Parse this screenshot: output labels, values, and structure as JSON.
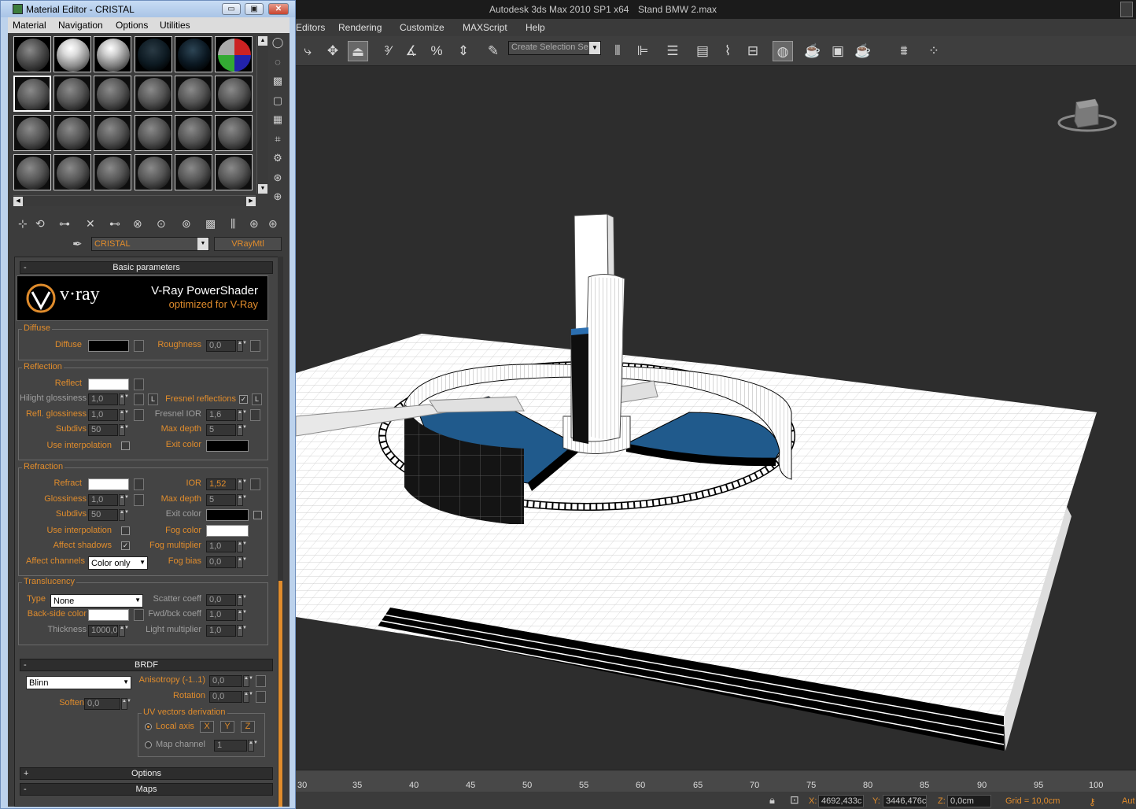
{
  "app": {
    "title_app": "Autodesk 3ds Max  2010 SP1 x64",
    "title_file": "Stand BMW 2.max",
    "menu": [
      "Editors",
      "Rendering",
      "Customize",
      "MAXScript",
      "Help"
    ],
    "selection_set_placeholder": "Create Selection Se",
    "timeline_ticks": [
      "30",
      "35",
      "40",
      "45",
      "50",
      "55",
      "60",
      "65",
      "70",
      "75",
      "80",
      "85",
      "90",
      "95",
      "100"
    ],
    "status": {
      "x_label": "X:",
      "x_value": "4692,433c",
      "y_label": "Y:",
      "y_value": "3446,476c",
      "z_label": "Z:",
      "z_value": "0,0cm",
      "grid": "Grid = 10,0cm",
      "auto": "Aut"
    }
  },
  "material_editor": {
    "title": "Material Editor - CRISTAL",
    "window_buttons": {
      "minimize": "▭",
      "restore": "▣",
      "close": "✕"
    },
    "menu": [
      "Material",
      "Navigation",
      "Options",
      "Utilities"
    ],
    "material_name": "CRISTAL",
    "material_type": "VRayMtl",
    "rollouts": {
      "basic": "Basic parameters",
      "brdf": "BRDF",
      "options": "Options",
      "maps": "Maps"
    },
    "vray_banner": {
      "brand": "v·ray",
      "line1": "V-Ray PowerShader",
      "line2": "optimized for V-Ray"
    },
    "diffuse": {
      "group": "Diffuse",
      "diffuse_label": "Diffuse",
      "diffuse_color": "#000000",
      "roughness_label": "Roughness",
      "roughness_value": "0,0"
    },
    "reflection": {
      "group": "Reflection",
      "reflect_label": "Reflect",
      "reflect_color": "#ffffff",
      "hilight_label": "Hilight glossiness",
      "hilight_value": "1,0",
      "l_button": "L",
      "fresnel_label": "Fresnel reflections",
      "fresnel_checked": "✓",
      "refl_gloss_label": "Refl. glossiness",
      "refl_gloss_value": "1,0",
      "fresnel_ior_label": "Fresnel IOR",
      "fresnel_ior_value": "1,6",
      "subdivs_label": "Subdivs",
      "subdivs_value": "50",
      "max_depth_label": "Max depth",
      "max_depth_value": "5",
      "use_interp_label": "Use interpolation",
      "exit_color_label": "Exit color",
      "exit_color": "#000000"
    },
    "refraction": {
      "group": "Refraction",
      "refract_label": "Refract",
      "refract_color": "#ffffff",
      "ior_label": "IOR",
      "ior_value": "1,52",
      "gloss_label": "Glossiness",
      "gloss_value": "1,0",
      "max_depth_label": "Max depth",
      "max_depth_value": "5",
      "subdivs_label": "Subdivs",
      "subdivs_value": "50",
      "exit_color_label": "Exit color",
      "exit_color": "#000000",
      "use_interp_label": "Use interpolation",
      "fog_color_label": "Fog color",
      "fog_color": "#ffffff",
      "affect_shadows_label": "Affect shadows",
      "affect_shadows_checked": "✓",
      "fog_mult_label": "Fog multiplier",
      "fog_mult_value": "1,0",
      "affect_channels_label": "Affect channels",
      "affect_channels_value": "Color only",
      "fog_bias_label": "Fog bias",
      "fog_bias_value": "0,0"
    },
    "translucency": {
      "group": "Translucency",
      "type_label": "Type",
      "type_value": "None",
      "scatter_label": "Scatter coeff",
      "scatter_value": "0,0",
      "backside_label": "Back-side color",
      "backside_color": "#ffffff",
      "fwdbck_label": "Fwd/bck coeff",
      "fwdbck_value": "1,0",
      "thickness_label": "Thickness",
      "thickness_value": "1000,0",
      "light_mult_label": "Light multiplier",
      "light_mult_value": "1,0"
    },
    "brdf": {
      "type_value": "Blinn",
      "aniso_label": "Anisotropy (-1..1)",
      "aniso_value": "0,0",
      "rotation_label": "Rotation",
      "rotation_value": "0,0",
      "soften_label": "Soften",
      "soften_value": "0,0",
      "uv_group": "UV vectors derivation",
      "local_axis_label": "Local axis",
      "axes": [
        "X",
        "Y",
        "Z"
      ],
      "map_channel_label": "Map channel",
      "map_channel_value": "1"
    },
    "rollout_signs": {
      "minus": "-",
      "plus": "+"
    }
  }
}
